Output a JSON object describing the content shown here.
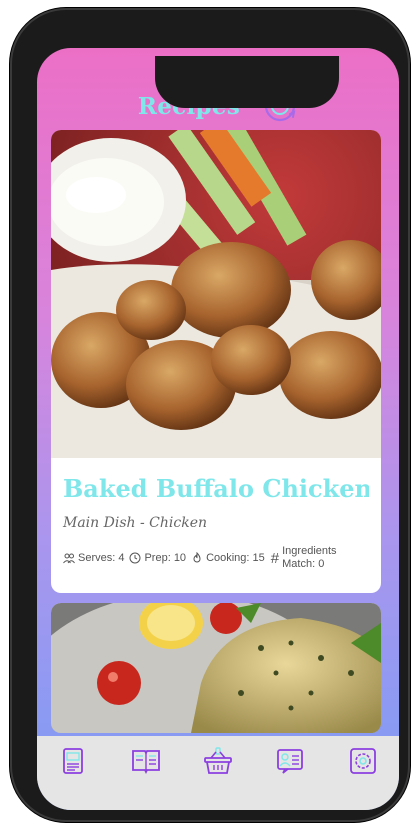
{
  "header": {
    "title": "Recipes",
    "refresh_icon": "refresh-icon"
  },
  "recipes": [
    {
      "title": "Baked Buffalo Chicken...",
      "subtitle": "Main Dish - Chicken",
      "serves": "Serves: 4",
      "prep": "Prep: 10",
      "cooking": "Cooking: 15",
      "ingredients_label_line1": "Ingredients",
      "ingredients_label_line2": "Match: 0"
    },
    {
      "title": "",
      "subtitle": ""
    }
  ],
  "tabbar": {
    "items": [
      {
        "icon": "recipe-card-icon"
      },
      {
        "icon": "recipe-book-icon"
      },
      {
        "icon": "shopping-basket-icon"
      },
      {
        "icon": "user-profile-icon"
      },
      {
        "icon": "settings-icon"
      }
    ]
  },
  "colors": {
    "accent": "#7fe6ea",
    "icon": "#8b3fe0",
    "gradient_top": "#ec6fc6",
    "gradient_bottom": "#7c9cf5"
  }
}
